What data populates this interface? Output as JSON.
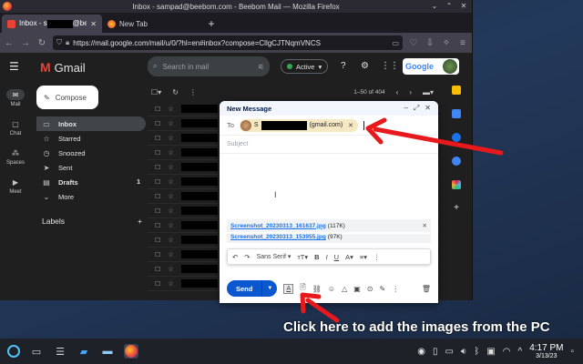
{
  "firefox": {
    "window_title": "Inbox - sampad@beebom.com - Beebom Mail — Mozilla Firefox",
    "tabs": [
      {
        "label_prefix": "Inbox - s",
        "label_suffix": "@beebom",
        "active": true
      },
      {
        "label": "New Tab",
        "active": false
      }
    ],
    "url": "https://mail.google.com/mail/u/0/?hl=en#inbox?compose=CllgCJTNqmVNCS",
    "new_tab_symbol": "+"
  },
  "gmail": {
    "brand": "Gmail",
    "compose_label": "Compose",
    "rail": [
      {
        "label": "Mail",
        "icon": "mail-icon"
      },
      {
        "label": "Chat",
        "icon": "chat-icon"
      },
      {
        "label": "Spaces",
        "icon": "spaces-icon"
      },
      {
        "label": "Meet",
        "icon": "meet-icon"
      }
    ],
    "nav": [
      {
        "label": "Inbox",
        "icon": "inbox-icon",
        "count": ""
      },
      {
        "label": "Starred",
        "icon": "star-icon",
        "count": ""
      },
      {
        "label": "Snoozed",
        "icon": "clock-icon",
        "count": ""
      },
      {
        "label": "Sent",
        "icon": "send-icon",
        "count": ""
      },
      {
        "label": "Drafts",
        "icon": "draft-icon",
        "count": "1"
      },
      {
        "label": "More",
        "icon": "chevron-down-icon",
        "count": ""
      }
    ],
    "labels_heading": "Labels",
    "search_placeholder": "Search in mail",
    "status": "Active",
    "google_badge": "Google",
    "pager": "1–50 of 404"
  },
  "compose": {
    "title": "New Message",
    "to_label": "To",
    "recipient_initial": "S",
    "recipient_domain": "(gmail.com)",
    "subject_placeholder": "Subject",
    "attachments": [
      {
        "name": "Screenshot_20230313_161637.jpg",
        "size": "(117K)"
      },
      {
        "name": "Screenshot_20230313_153955.jpg",
        "size": "(97K)"
      }
    ],
    "font": "Sans Serif",
    "send_label": "Send"
  },
  "annotation": {
    "caption": "Click here to add the images from the PC",
    "arrow_color": "#e8191c"
  },
  "taskbar": {
    "time": "4:17 PM",
    "date": "3/13/23"
  }
}
